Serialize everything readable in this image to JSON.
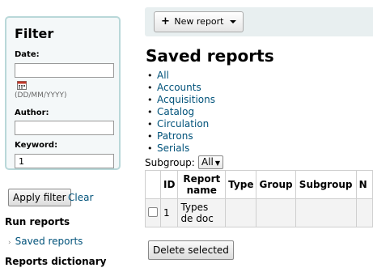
{
  "sidebar": {
    "filter": {
      "title": "Filter",
      "date_label": "Date:",
      "date_value": "",
      "date_hint": "(DD/MM/YYYY)",
      "author_label": "Author:",
      "author_value": "",
      "keyword_label": "Keyword:",
      "keyword_value": "1",
      "apply_label": "Apply filter",
      "clear_label": "Clear"
    },
    "run_reports": "Run reports",
    "saved_reports": "Saved reports",
    "reports_dictionary": "Reports dictionary"
  },
  "toolbar": {
    "new_report_label": "New report"
  },
  "main": {
    "title": "Saved reports",
    "groups": [
      "All",
      "Accounts",
      "Acquisitions",
      "Catalog",
      "Circulation",
      "Patrons",
      "Serials"
    ],
    "subgroup_label": "Subgroup:",
    "subgroup_value": "All",
    "table": {
      "headers": [
        "",
        "ID",
        "Report name",
        "Type",
        "Group",
        "Subgroup",
        "N"
      ],
      "rows": [
        {
          "id": "1",
          "name": "Types de doc",
          "type": "",
          "group": "",
          "subgroup": ""
        }
      ]
    },
    "delete_label": "Delete selected"
  }
}
